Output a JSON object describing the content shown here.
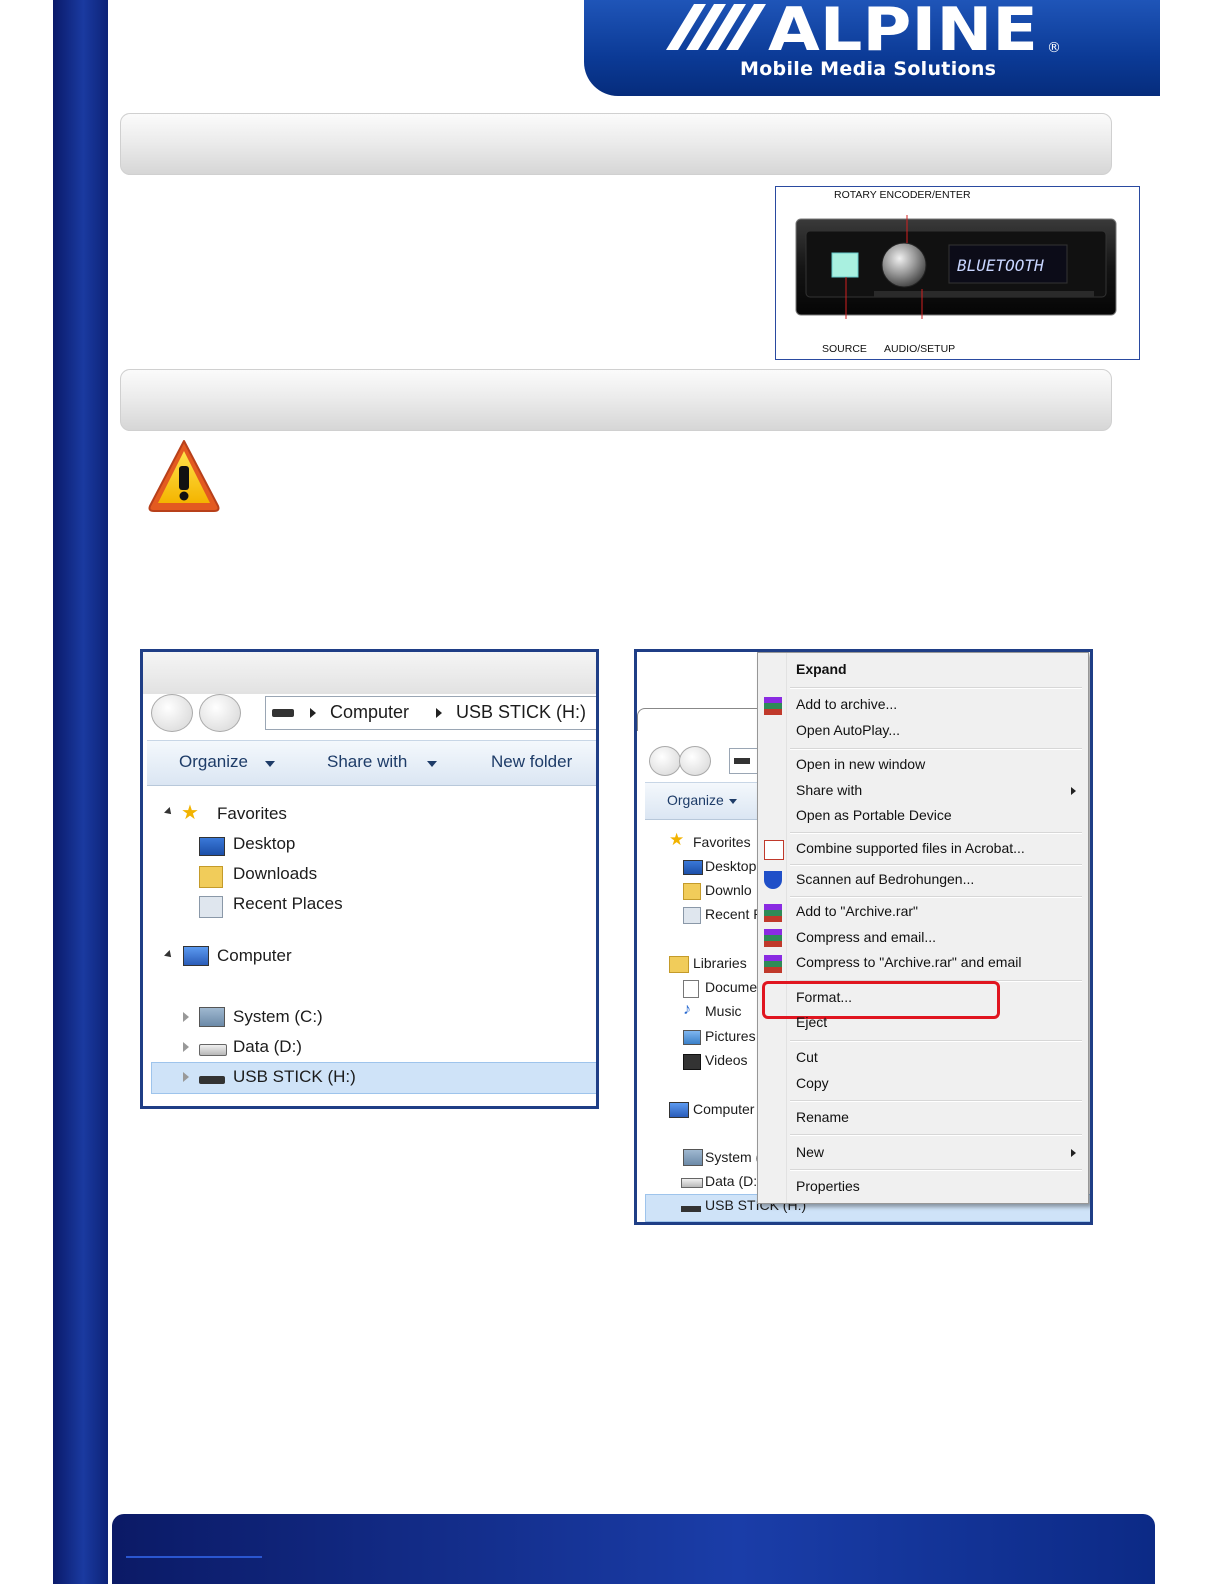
{
  "brand": {
    "name": "ALPINE",
    "registered": "®",
    "tagline": "Mobile Media Solutions",
    "color_primary": "#0b3a96"
  },
  "radio_figure": {
    "display_text": "BLUETOOTH",
    "labels": {
      "top": "ROTARY ENCODER/ENTER",
      "bottom_left": "SOURCE",
      "bottom_right": "AUDIO/SETUP"
    }
  },
  "warning_icon": "warning-triangle-icon",
  "explorer_left": {
    "address": [
      "Computer",
      "USB STICK (H:)"
    ],
    "toolbar": [
      "Organize",
      "Share with",
      "New folder"
    ],
    "tree": {
      "favorites": "Favorites",
      "favorites_items": [
        "Desktop",
        "Downloads",
        "Recent Places"
      ],
      "computer": "Computer",
      "drives": [
        "System (C:)",
        "Data (D:)",
        "USB STICK (H:)"
      ]
    }
  },
  "explorer_right": {
    "toolbar": [
      "Organize"
    ],
    "tree": {
      "favorites": "Favorites",
      "favorites_items": [
        "Desktop",
        "Downlo",
        "Recent P"
      ],
      "libraries": "Libraries",
      "library_items": [
        "Docume",
        "Music",
        "Pictures",
        "Videos"
      ],
      "computer": "Computer",
      "drives": [
        "System (",
        "Data (D:",
        "USB STICK (H:)"
      ]
    },
    "context_menu": [
      "Expand",
      "Add to archive...",
      "Open AutoPlay...",
      "Open in new window",
      "Share with",
      "Open as Portable Device",
      "Combine supported files in Acrobat...",
      "Scannen auf Bedrohungen...",
      "Add to \"Archive.rar\"",
      "Compress and email...",
      "Compress to \"Archive.rar\" and email",
      "Format...",
      "Eject",
      "Cut",
      "Copy",
      "Rename",
      "New",
      "Properties"
    ],
    "highlighted_item": "Format...",
    "highlight_color": "#e0151f"
  }
}
